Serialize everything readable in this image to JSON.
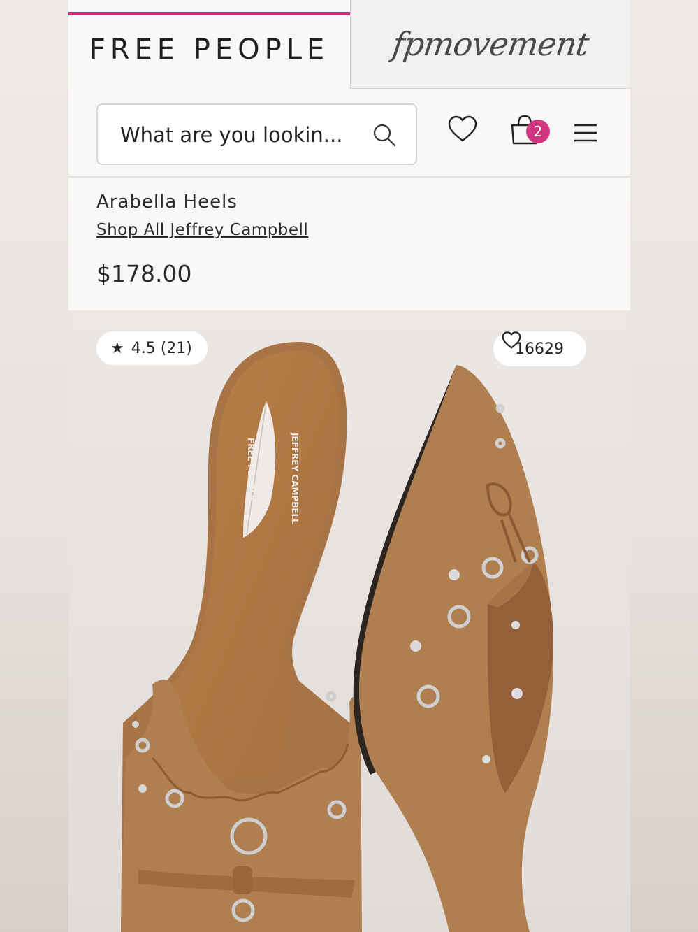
{
  "brand_tabs": {
    "free_people": "FREE PEOPLE",
    "movement": "fpmovement"
  },
  "header": {
    "search_placeholder": "What are you lookin...",
    "cart_count": "2"
  },
  "product": {
    "name": "Arabella Heels",
    "brand_link": "Shop All Jeffrey Campbell",
    "price": "$178.00"
  },
  "image_overlay": {
    "rating": "4.5 (21)",
    "likes": "16629",
    "insole_text_1": "JEFFREY CAMPBELL",
    "insole_text_2": "FREE PEOPLE"
  },
  "colors": {
    "accent_pink": "#c2317a",
    "badge_pink": "#d1357f",
    "suede": "#b07f4f"
  }
}
